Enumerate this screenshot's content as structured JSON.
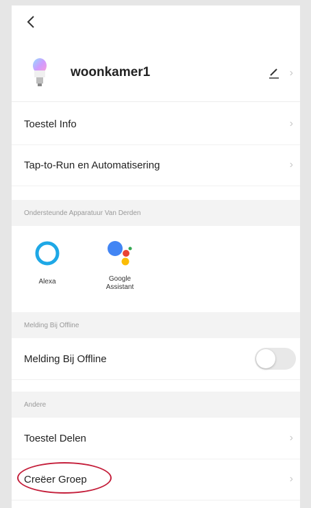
{
  "header": {
    "back_icon": "chevron-left-icon"
  },
  "device": {
    "name": "woonkamer1",
    "icon": "bulb-icon"
  },
  "rows": [
    {
      "label": "Toestel Info"
    },
    {
      "label": "Tap-to-Run en Automatisering"
    }
  ],
  "section_third_party": {
    "title": "Ondersteunde Apparatuur Van Derden"
  },
  "assistants": [
    {
      "label": "Alexa"
    },
    {
      "label_line1": "Google",
      "label_line2": "Assistant"
    }
  ],
  "section_offline": {
    "title": "Melding Bij Offline"
  },
  "offline_toggle": {
    "label": "Melding Bij Offline",
    "enabled": false
  },
  "section_other": {
    "title": "Andere"
  },
  "other_rows": [
    {
      "label": "Toestel Delen"
    },
    {
      "label": "Creëer Groep"
    }
  ],
  "colors": {
    "highlight": "#c41e3a",
    "alexa": "#1ea8e6",
    "google_blue": "#4285f4",
    "google_red": "#ea4335",
    "google_yellow": "#fbbc05",
    "google_green": "#34a853"
  }
}
